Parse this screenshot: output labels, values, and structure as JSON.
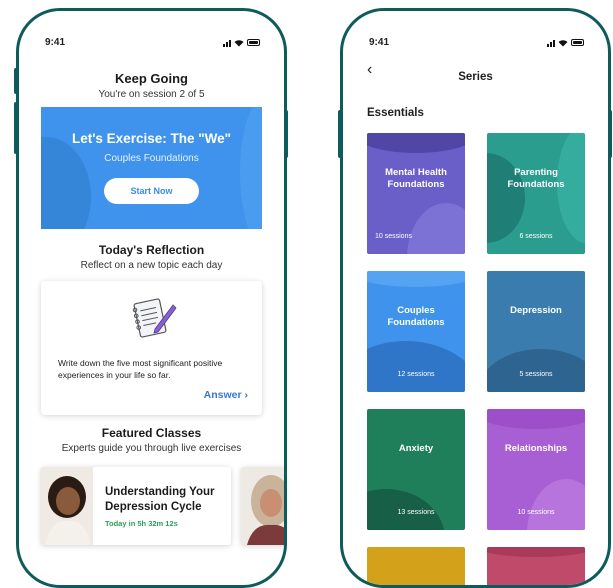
{
  "status": {
    "time_left": "9:41",
    "time_right": "9:41"
  },
  "home": {
    "header": {
      "title": "Keep Going",
      "subtitle": "You're on session 2 of 5"
    },
    "hero": {
      "title": "Let's Exercise: The \"We\"",
      "subtitle": "Couples Foundations",
      "button": "Start Now",
      "color": "#3f93ec"
    },
    "reflection": {
      "title": "Today's Reflection",
      "subtitle": "Reflect on a new topic each day",
      "prompt": "Write down the five most significant positive experiences in your life so far.",
      "answer": "Answer",
      "icon": "notepad-pencil-icon"
    },
    "featured": {
      "title": "Featured Classes",
      "subtitle": "Experts guide you through live exercises",
      "classes": [
        {
          "title": "Understanding Your Depression Cycle",
          "time": "Today in 5h 32m 12s"
        }
      ]
    }
  },
  "series": {
    "title": "Series",
    "section": "Essentials",
    "tiles": [
      {
        "name": "Mental Health Foundations",
        "sessions": "10 sessions",
        "color": "#6a5fc8",
        "shade": "#7c72d6"
      },
      {
        "name": "Parenting Foundations",
        "sessions": "6 sessions",
        "color": "#2a9d8f",
        "shade": "#1f7f76"
      },
      {
        "name": "Couples Foundations",
        "sessions": "12 sessions",
        "color": "#3f93ec",
        "shade": "#2f76c8"
      },
      {
        "name": "Depression",
        "sessions": "5 sessions",
        "color": "#3a7cae",
        "shade": "#2d6590"
      },
      {
        "name": "Anxiety",
        "sessions": "13 sessions",
        "color": "#1e7f5a",
        "shade": "#175f46"
      },
      {
        "name": "Relationships",
        "sessions": "10 sessions",
        "color": "#a85fd3",
        "shade": "#9c4fc8"
      }
    ]
  }
}
